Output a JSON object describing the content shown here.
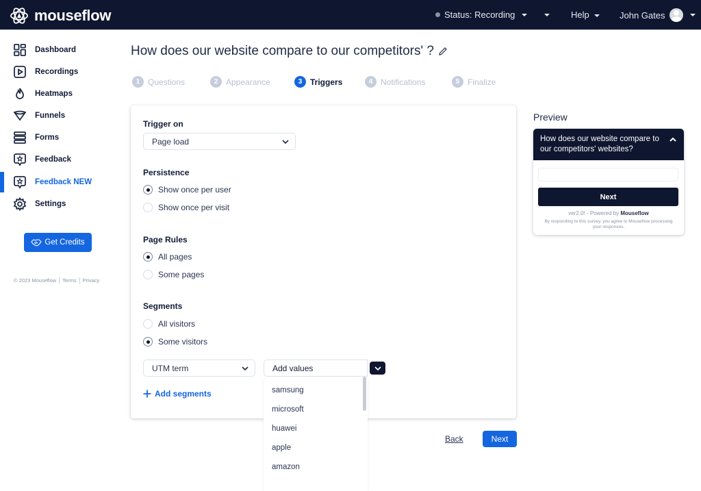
{
  "topbar": {
    "brand": "mouseflow",
    "status_label": "Status: Recording",
    "help_label": "Help",
    "user_name": "John Gates"
  },
  "sidebar": {
    "items": [
      {
        "label": "Dashboard",
        "icon": "dashboard-icon"
      },
      {
        "label": "Recordings",
        "icon": "play-icon"
      },
      {
        "label": "Heatmaps",
        "icon": "flame-icon"
      },
      {
        "label": "Funnels",
        "icon": "funnel-icon"
      },
      {
        "label": "Forms",
        "icon": "forms-icon"
      },
      {
        "label": "Feedback",
        "icon": "feedback-icon"
      },
      {
        "label": "Feedback NEW",
        "icon": "feedback-icon",
        "active": true
      },
      {
        "label": "Settings",
        "icon": "gear-icon"
      }
    ],
    "get_credits_label": "Get Credits",
    "footer": {
      "copyright": "© 2023 Mouseflow",
      "terms": "Terms",
      "privacy": "Privacy"
    }
  },
  "main": {
    "title": "How does our website compare to our competitors' ?",
    "steps": [
      {
        "num": "1",
        "label": "Questions"
      },
      {
        "num": "2",
        "label": "Appearance"
      },
      {
        "num": "3",
        "label": "Triggers",
        "active": true
      },
      {
        "num": "4",
        "label": "Notifications"
      },
      {
        "num": "5",
        "label": "Finalize"
      }
    ],
    "trigger_on": {
      "label": "Trigger on",
      "value": "Page load"
    },
    "persistence": {
      "label": "Persistence",
      "options": [
        {
          "label": "Show once per user",
          "checked": true
        },
        {
          "label": "Show once per visit",
          "checked": false
        }
      ]
    },
    "page_rules": {
      "label": "Page Rules",
      "options": [
        {
          "label": "All pages",
          "checked": true
        },
        {
          "label": "Some pages",
          "checked": false
        }
      ]
    },
    "segments": {
      "label": "Segments",
      "options": [
        {
          "label": "All visitors",
          "checked": false
        },
        {
          "label": "Some visitors",
          "checked": true
        }
      ],
      "segment_type": "UTM term",
      "values_placeholder": "Add values",
      "add_segments_label": "Add segments",
      "dropdown_options": [
        "samsung",
        "microsoft",
        "huawei",
        "apple",
        "amazon"
      ]
    },
    "back_label": "Back",
    "next_label": "Next"
  },
  "preview": {
    "label": "Preview",
    "question": "How does our website compare to our competitors' websites?",
    "next_label": "Next",
    "powered_prefix": "ver2.0! - Powered by",
    "powered_brand": "Mouseflow",
    "consent": "By responding to this survey, you agree to Mouseflow processing your responses."
  },
  "colors": {
    "navy": "#0e1630",
    "accent": "#1466e0",
    "muted_step": "#c6cedd"
  }
}
